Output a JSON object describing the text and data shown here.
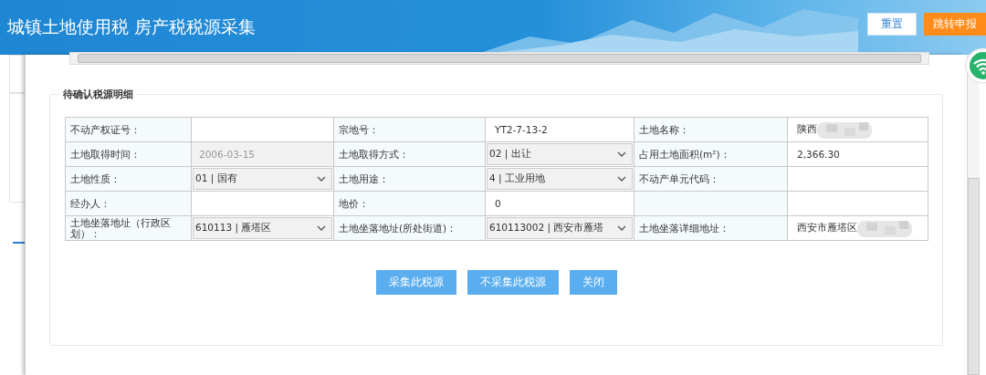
{
  "header": {
    "title": "城镇土地使用税 房产税税源采集",
    "buttons": [
      {
        "label": "重置",
        "kind": "plain"
      },
      {
        "label": "跳转申报",
        "kind": "primary"
      }
    ]
  },
  "dialog": {
    "section_title": "待确认税源明细",
    "rows": [
      [
        {
          "label": "不动产权证号：",
          "value": {
            "kind": "text"
          }
        },
        {
          "label": "宗地号：",
          "value": {
            "kind": "text",
            "text": "YT2-7-13-2"
          }
        },
        {
          "label": "土地名称：",
          "value": {
            "kind": "blurred",
            "text": "陕西"
          }
        }
      ],
      [
        {
          "label": "土地取得时间：",
          "value": {
            "kind": "disabled",
            "text": "2006-03-15"
          }
        },
        {
          "label": "土地取得方式：",
          "value": {
            "kind": "select",
            "text": "02 | 出让"
          }
        },
        {
          "label": "占用土地面积(m²)：",
          "value": {
            "kind": "text",
            "text": "2,366.30"
          }
        }
      ],
      [
        {
          "label": "土地性质：",
          "value": {
            "kind": "select",
            "text": "01 | 国有"
          }
        },
        {
          "label": "土地用途：",
          "value": {
            "kind": "select",
            "text": "4 | 工业用地"
          }
        },
        {
          "label": "不动产单元代码：",
          "value": {
            "kind": "text"
          }
        }
      ],
      [
        {
          "label": "经办人：",
          "value": {
            "kind": "text"
          }
        },
        {
          "label": "地价：",
          "value": {
            "kind": "text",
            "text": "0"
          }
        },
        {
          "value": {
            "kind": "text"
          }
        }
      ],
      [
        {
          "label": "土地坐落地址（行政区划）：",
          "value": {
            "kind": "select",
            "text": "610113 | 雁塔区"
          }
        },
        {
          "label": "土地坐落地址(所处街道)：",
          "value": {
            "kind": "select",
            "text": "610113002 | 西安市雁塔"
          }
        },
        {
          "label": "土地坐落详细地址：",
          "value": {
            "kind": "blurred",
            "text": "西安市雁塔区"
          }
        }
      ]
    ],
    "buttons": [
      {
        "label": "采集此税源"
      },
      {
        "label": "不采集此税源"
      },
      {
        "label": "关闭"
      }
    ]
  }
}
